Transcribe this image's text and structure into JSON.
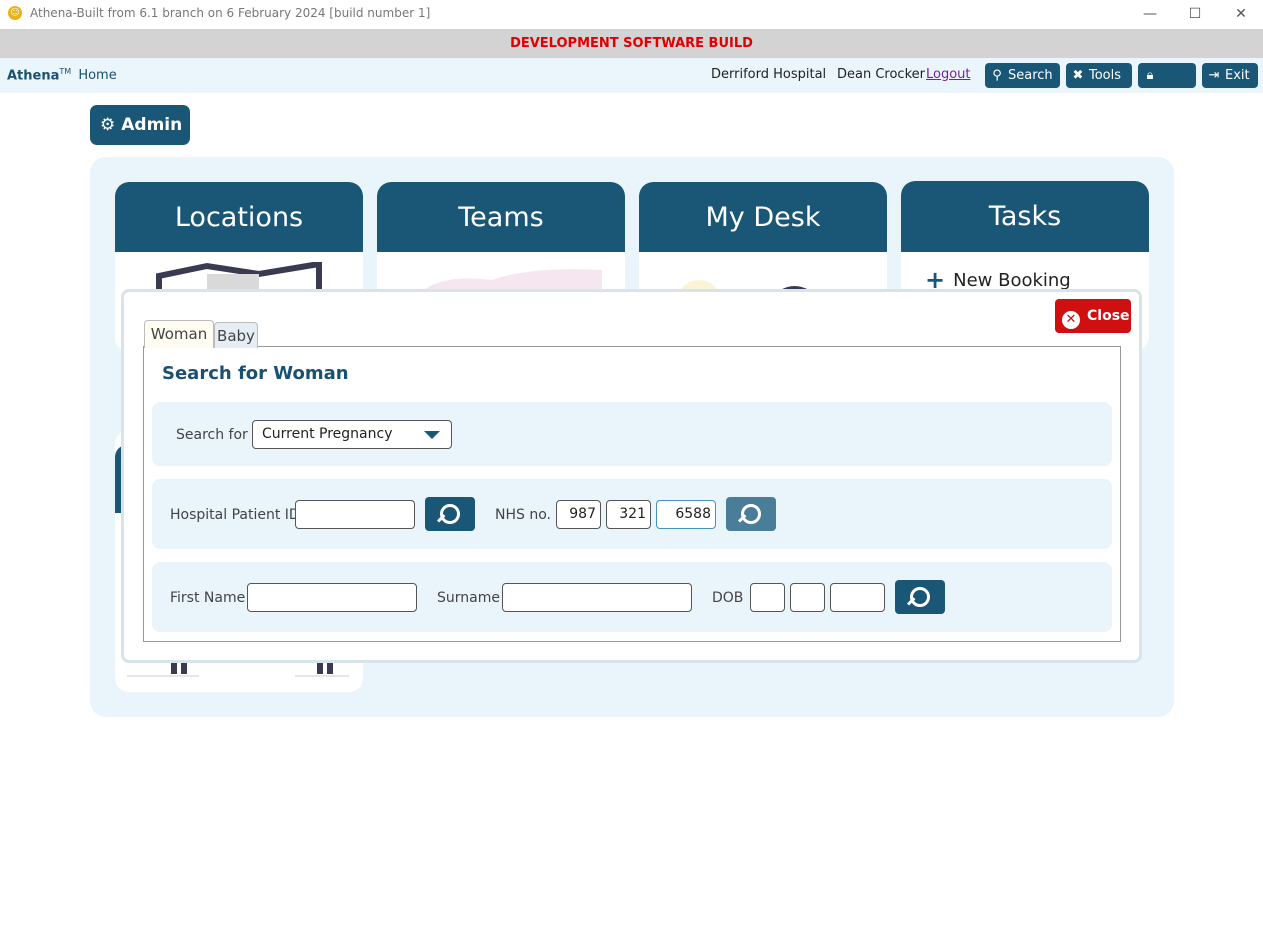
{
  "window": {
    "title": "Athena-Built from 6.1 branch on 6 February 2024 [build number 1]",
    "minimize": "—",
    "maximize": "☐",
    "close": "✕"
  },
  "devbar": {
    "text": "DEVELOPMENT SOFTWARE BUILD"
  },
  "nav": {
    "brand": "Athena",
    "tm": "TM",
    "home": "Home",
    "hospital": "Derriford Hospital",
    "user": "Dean Crocker",
    "logout": "Logout",
    "buttons": {
      "search": "Search",
      "tools": "Tools",
      "lock": "Lock",
      "exit": "Exit"
    }
  },
  "admin": {
    "label": "Admin"
  },
  "cards": {
    "locations": "Locations",
    "teams": "Teams",
    "mydesk": "My Desk",
    "tasks": "Tasks",
    "new_booking": "New Booking"
  },
  "modal": {
    "close": "Close",
    "tabs": {
      "woman": "Woman",
      "baby": "Baby"
    },
    "title": "Search for Woman",
    "search_for": {
      "label": "Search for",
      "value": "Current Pregnancy"
    },
    "hospital_patient_id": {
      "label": "Hospital Patient ID",
      "value": ""
    },
    "nhs": {
      "label": "NHS no.",
      "part1": "987",
      "part2": "321",
      "part3": "6588"
    },
    "first_name": {
      "label": "First Name",
      "value": ""
    },
    "surname": {
      "label": "Surname",
      "value": ""
    },
    "dob": {
      "label": "DOB",
      "day": "",
      "month": "",
      "year": ""
    }
  },
  "colors": {
    "brand": "#1a5676",
    "dev_banner": "#e00000",
    "close": "#d01010",
    "panel_bg": "#e9f5fb"
  }
}
